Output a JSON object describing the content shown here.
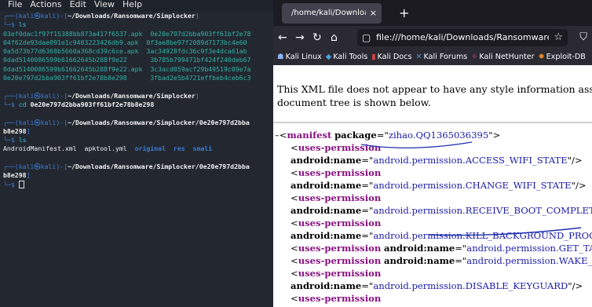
{
  "terminal": {
    "menu": [
      "File",
      "Actions",
      "Edit",
      "View",
      "Help"
    ],
    "lines": [
      [
        {
          "t": "┌──(",
          "c": "blue"
        },
        {
          "t": "kali㉿kali",
          "c": "blue"
        },
        {
          "t": ")-[",
          "c": "blue"
        },
        {
          "t": "~/Downloads/Ransomware/Simplocker",
          "c": "white bold"
        },
        {
          "t": "]",
          "c": "blue"
        }
      ],
      [
        {
          "t": "└─$ ",
          "c": "blue"
        },
        {
          "t": "ls",
          "c": "cyan"
        }
      ],
      [
        {
          "t": "03ef0dac1f97f15388bb873a417f6537.apk  0e20e797d2bba903ff61bf2e78",
          "c": "teal"
        }
      ],
      [
        {
          "t": "04f62de93dae091e1c9483223426db9.apk  0f3ae8be97f2089d7173bc4e60",
          "c": "teal"
        }
      ],
      [
        {
          "t": "0a5d73b77d6360b5660a368cd39c6ce.apk  3ac34928fdc36c9f3e4dca61ab",
          "c": "teal"
        }
      ],
      [
        {
          "t": "0dad5140086599b61662645b288f9e22      3b785b799471bf424f240deb67",
          "c": "teal"
        }
      ],
      [
        {
          "t": "0dad5140086599b61662645b288f9e22.apk  3c3acd059acf29b49519c09e7a",
          "c": "teal"
        }
      ],
      [
        {
          "t": "0e20e797d2bba903ff61bf2e78b8e298      3fbad2e5b4721effbeb4ceb6c3",
          "c": "teal"
        }
      ],
      [
        {
          "t": "",
          "c": "white"
        }
      ],
      [
        {
          "t": "┌──(",
          "c": "blue"
        },
        {
          "t": "kali㉿kali",
          "c": "blue"
        },
        {
          "t": ")-[",
          "c": "blue"
        },
        {
          "t": "~/Downloads/Ransomware/Simplocker",
          "c": "white bold"
        },
        {
          "t": "]",
          "c": "blue"
        }
      ],
      [
        {
          "t": "└─$ ",
          "c": "blue"
        },
        {
          "t": "cd ",
          "c": "cyan"
        },
        {
          "t": "0e20e797d2bba903ff61bf2e78b8e298",
          "c": "white bold"
        }
      ],
      [
        {
          "t": "",
          "c": "white"
        }
      ],
      [
        {
          "t": "┌──(",
          "c": "blue"
        },
        {
          "t": "kali㉿kali",
          "c": "blue"
        },
        {
          "t": ")-[",
          "c": "blue"
        },
        {
          "t": "~/Downloads/Ransomware/Simplocker/0e20e797d2bba",
          "c": "white bold"
        }
      ],
      [
        {
          "t": "b8e298",
          "c": "white bold"
        },
        {
          "t": "]",
          "c": "blue"
        }
      ],
      [
        {
          "t": "└─$ ",
          "c": "blue"
        },
        {
          "t": "ls",
          "c": "cyan"
        }
      ],
      [
        {
          "t": "AndroidManifest.xml  apktool.yml  ",
          "c": "white"
        },
        {
          "t": "original  res  smali",
          "c": "blue bold"
        }
      ],
      [
        {
          "t": "",
          "c": "white"
        }
      ],
      [
        {
          "t": "┌──(",
          "c": "blue"
        },
        {
          "t": "kali㉿kali",
          "c": "blue"
        },
        {
          "t": ")-[",
          "c": "blue"
        },
        {
          "t": "~/Downloads/Ransomware/Simplocker/0e20e797d2bba",
          "c": "white bold"
        }
      ],
      [
        {
          "t": "b8e298",
          "c": "white bold"
        },
        {
          "t": "]",
          "c": "blue"
        }
      ],
      [
        {
          "t": "└─$ ",
          "c": "blue"
        }
      ]
    ]
  },
  "browser": {
    "tab_title": "/home/kali/Downloads/Ransc",
    "tab_close": "×",
    "new_tab": "+",
    "url": "file:///home/kali/Downloads/Ransomware/Simpl",
    "bookmarks": [
      {
        "icon": "kali",
        "label": "Kali Linux"
      },
      {
        "icon": "tools",
        "label": "Kali Tools"
      },
      {
        "icon": "docs",
        "label": "Kali Docs"
      },
      {
        "icon": "forums",
        "label": "Kali Forums"
      },
      {
        "icon": "nethunter",
        "label": "Kali NetHunter"
      },
      {
        "icon": "exploit",
        "label": "Exploit-DB"
      }
    ],
    "info_line1": "This XML file does not appear to have any style information associated with it",
    "info_line2": "document tree is shown below.",
    "xml_lines": [
      {
        "indent": 2,
        "minus": "–",
        "parts": [
          {
            "k": "sym",
            "t": "<"
          },
          {
            "k": "tag",
            "t": "manifest"
          },
          {
            "k": "sym",
            "t": " "
          },
          {
            "k": "attr",
            "t": "package"
          },
          {
            "k": "sym",
            "t": "=\""
          },
          {
            "k": "val",
            "t": "zihao.QQ1365036395"
          },
          {
            "k": "sym",
            "t": "\">"
          }
        ]
      },
      {
        "indent": 22,
        "parts": [
          {
            "k": "sym",
            "t": "<"
          },
          {
            "k": "tag",
            "t": "uses-permission"
          }
        ]
      },
      {
        "indent": 22,
        "parts": [
          {
            "k": "attr",
            "t": "android:name"
          },
          {
            "k": "sym",
            "t": "=\""
          },
          {
            "k": "val",
            "t": "android.permission.ACCESS_WIFI_STATE"
          },
          {
            "k": "sym",
            "t": "\"/>"
          }
        ]
      },
      {
        "indent": 22,
        "parts": [
          {
            "k": "sym",
            "t": "<"
          },
          {
            "k": "tag",
            "t": "uses-permission"
          }
        ]
      },
      {
        "indent": 22,
        "parts": [
          {
            "k": "attr",
            "t": "android:name"
          },
          {
            "k": "sym",
            "t": "=\""
          },
          {
            "k": "val",
            "t": "android.permission.CHANGE_WIFI_STATE"
          },
          {
            "k": "sym",
            "t": "\"/>"
          }
        ]
      },
      {
        "indent": 22,
        "parts": [
          {
            "k": "sym",
            "t": "<"
          },
          {
            "k": "tag",
            "t": "uses-permission"
          }
        ]
      },
      {
        "indent": 22,
        "parts": [
          {
            "k": "attr",
            "t": "android:name"
          },
          {
            "k": "sym",
            "t": "=\""
          },
          {
            "k": "val",
            "t": "android.permission.RECEIVE_BOOT_COMPLETED"
          },
          {
            "k": "sym",
            "t": "\"/>"
          }
        ]
      },
      {
        "indent": 22,
        "parts": [
          {
            "k": "sym",
            "t": "<"
          },
          {
            "k": "tag",
            "t": "uses-permission"
          }
        ]
      },
      {
        "indent": 22,
        "parts": [
          {
            "k": "attr",
            "t": "android:name"
          },
          {
            "k": "sym",
            "t": "=\""
          },
          {
            "k": "val",
            "t": "android.permission.KILL_BACKGROUND_PROCESSES"
          },
          {
            "k": "sym",
            "t": "\"/>"
          }
        ]
      },
      {
        "indent": 22,
        "parts": [
          {
            "k": "sym",
            "t": "<"
          },
          {
            "k": "tag",
            "t": "uses-permission"
          },
          {
            "k": "sym",
            "t": " "
          },
          {
            "k": "attr",
            "t": "android:name"
          },
          {
            "k": "sym",
            "t": "=\""
          },
          {
            "k": "val",
            "t": "android.permission.GET_TASKS"
          },
          {
            "k": "sym",
            "t": "\"/>"
          }
        ]
      },
      {
        "indent": 22,
        "parts": [
          {
            "k": "sym",
            "t": "<"
          },
          {
            "k": "tag",
            "t": "uses-permission"
          },
          {
            "k": "sym",
            "t": " "
          },
          {
            "k": "attr",
            "t": "android:name"
          },
          {
            "k": "sym",
            "t": "=\""
          },
          {
            "k": "val",
            "t": "android.permission.WAKE_LOCK"
          },
          {
            "k": "sym",
            "t": "\"/>"
          }
        ]
      },
      {
        "indent": 22,
        "parts": [
          {
            "k": "sym",
            "t": "<"
          },
          {
            "k": "tag",
            "t": "uses-permission"
          }
        ]
      },
      {
        "indent": 22,
        "parts": [
          {
            "k": "attr",
            "t": "android:name"
          },
          {
            "k": "sym",
            "t": "=\""
          },
          {
            "k": "val",
            "t": "android.permission.DISABLE_KEYGUARD"
          },
          {
            "k": "sym",
            "t": "\"/>"
          }
        ]
      },
      {
        "indent": 22,
        "parts": [
          {
            "k": "sym",
            "t": "<"
          },
          {
            "k": "tag",
            "t": "uses-permission"
          }
        ]
      }
    ]
  },
  "colors": {
    "terminal_bg": "#232830",
    "prompt": "#3c7bd6",
    "apk": "#2fb1a7",
    "tag": "#881280",
    "value": "#1a1aa6"
  }
}
